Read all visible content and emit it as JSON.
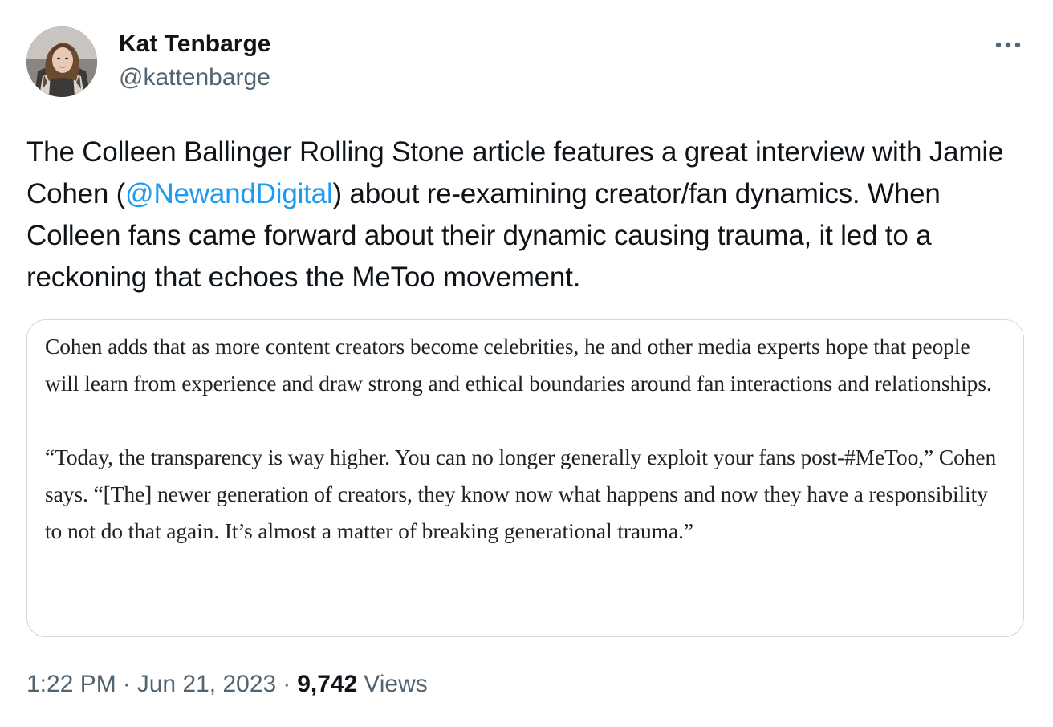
{
  "author": {
    "display_name": "Kat Tenbarge",
    "handle": "@kattenbarge"
  },
  "more_icon": "more-horizontal-icon",
  "tweet": {
    "text_before": "The Colleen Ballinger Rolling Stone article features a great interview with Jamie Cohen (",
    "mention": "@NewandDigital",
    "text_after": ") about re-examining creator/fan dynamics. When Colleen fans came forward about their dynamic causing trauma, it led to a reckoning that echoes the MeToo movement."
  },
  "media": {
    "paragraph_1": "Cohen adds that as more content creators become celebrities, he and other media experts hope that people will learn from experience and draw strong and ethical boundaries around fan interactions and relationships.",
    "paragraph_2": "“Today, the transparency is way higher. You can no longer generally exploit your fans post-#MeToo,” Cohen says. “[The] newer generation of creators, they know now what happens and now they have a responsibility to not do that again. It’s almost a matter of breaking generational trauma.”"
  },
  "meta": {
    "time": "1:22 PM",
    "separator": "·",
    "date": "Jun 21, 2023",
    "views_count": "9,742",
    "views_label": "Views"
  },
  "colors": {
    "text": "#0f1419",
    "secondary": "#536471",
    "link": "#1d9bf0",
    "border": "#cfd9de"
  }
}
